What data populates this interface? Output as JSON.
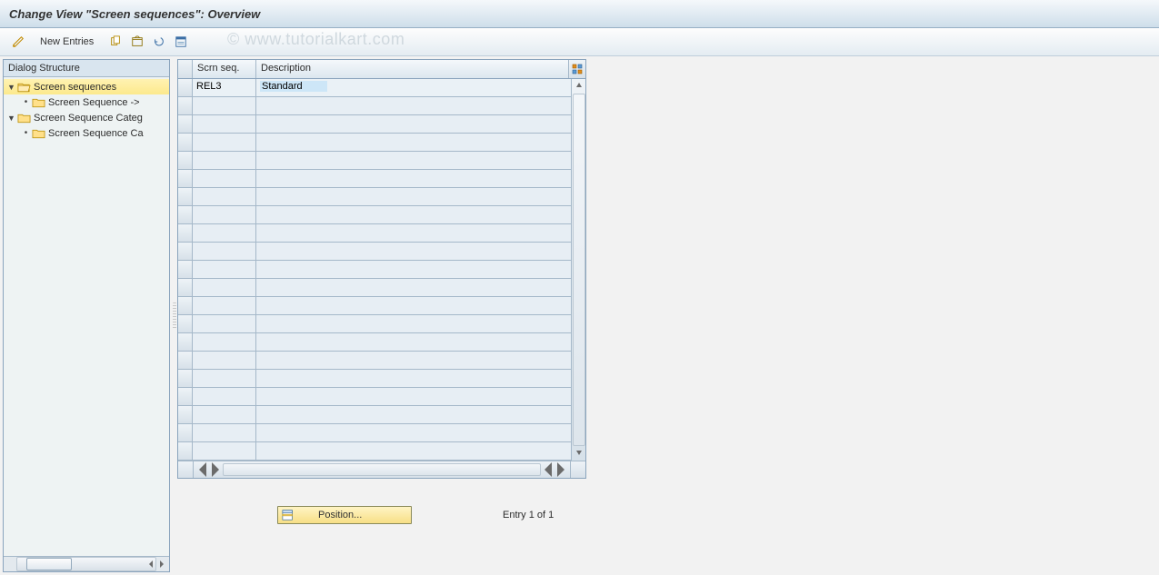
{
  "header": {
    "title": "Change View \"Screen sequences\": Overview"
  },
  "toolbar": {
    "new_entries_label": "New Entries"
  },
  "watermark": "© www.tutorialkart.com",
  "dialog_structure": {
    "title": "Dialog Structure",
    "items": [
      {
        "label": "Screen sequences",
        "expanded": true,
        "selected": true,
        "open": true,
        "depth": 1
      },
      {
        "label": "Screen Sequence ->",
        "expanded": false,
        "selected": false,
        "open": false,
        "depth": 2
      },
      {
        "label": "Screen Sequence Categ",
        "expanded": true,
        "selected": false,
        "open": false,
        "depth": 1
      },
      {
        "label": "Screen Sequence Ca",
        "expanded": false,
        "selected": false,
        "open": false,
        "depth": 2
      }
    ]
  },
  "table": {
    "columns": {
      "c1": "Scrn seq.",
      "c2": "Description"
    },
    "rows": [
      {
        "c1": "REL3",
        "c2": "Standard"
      }
    ],
    "empty_rows": 20
  },
  "footer": {
    "position_button": "Position...",
    "entry_text": "Entry 1 of 1"
  }
}
